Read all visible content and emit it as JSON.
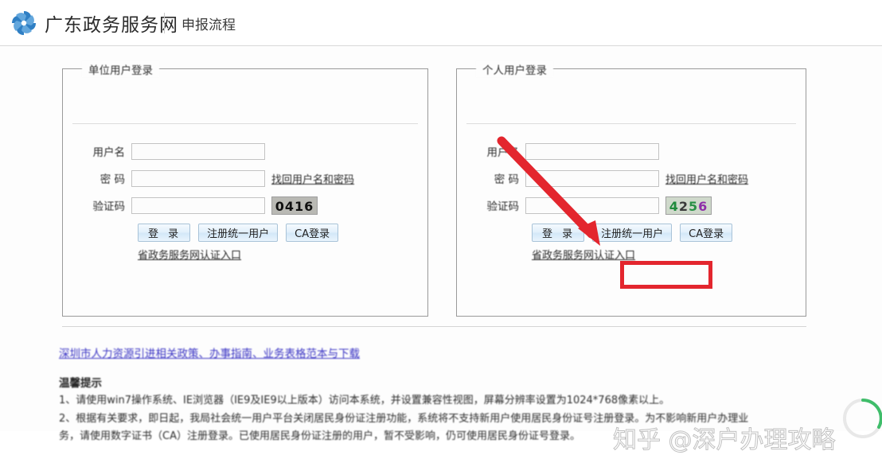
{
  "header": {
    "logo_icon": "pinwheel-logo-icon",
    "site_title": "广东政务服务网",
    "section_title": "申报流程"
  },
  "panels": {
    "corporate": {
      "legend": "单位用户登录",
      "fields": {
        "username_label": "用户名",
        "username_value": "",
        "password_label": "密 码",
        "password_value": "",
        "captcha_label": "验证码",
        "captcha_value": "",
        "captcha_image_text": "0416"
      },
      "recover_link": "找回用户名和密码",
      "buttons": {
        "login": "登 录",
        "register": "注册统一用户",
        "ca_login": "CA登录"
      },
      "auth_link": "省政务服务网认证入口"
    },
    "personal": {
      "legend": "个人用户登录",
      "fields": {
        "username_label": "用户名",
        "username_value": "",
        "password_label": "密 码",
        "password_value": "",
        "captcha_label": "验证码",
        "captcha_value": "",
        "captcha_image_chars": {
          "c1": "4",
          "c2": "2",
          "c3": "5",
          "c4": "6"
        }
      },
      "recover_link": "找回用户名和密码",
      "buttons": {
        "login": "登 录",
        "register": "注册统一用户",
        "ca_login": "CA登录"
      },
      "auth_link": "省政务服务网认证入口"
    }
  },
  "footer": {
    "policy_link": "深圳市人力资源引进相关政策、办事指南、业务表格范本与下载",
    "notice_title": "温馨提示",
    "notices": [
      "1、请使用win7操作系统、IE浏览器（IE9及IE9以上版本）访问本系统，并设置兼容性视图，屏幕分辨率设置为1024*768像素以上。",
      "2、根据有关要求，即日起，我局社会统一用户平台关闭居民身份证注册功能，系统将不支持新用户使用居民身份证号注册登录。为不影响新用户办理业",
      "务，请使用数字证书（CA）注册登录。已使用居民身份证注册的用户，暂不受影响，仍可使用居民身份证号登录。"
    ]
  },
  "annotations": {
    "arrow_color": "#e3262e",
    "highlight_box_color": "#e3262e",
    "highlight_target": "注册统一用户"
  },
  "watermark": {
    "text": "知乎 @深户办理攻略"
  },
  "colors": {
    "link_blue": "#3b35c4",
    "button_blue": "#d4e8f8",
    "annotation_red": "#e3262e"
  }
}
